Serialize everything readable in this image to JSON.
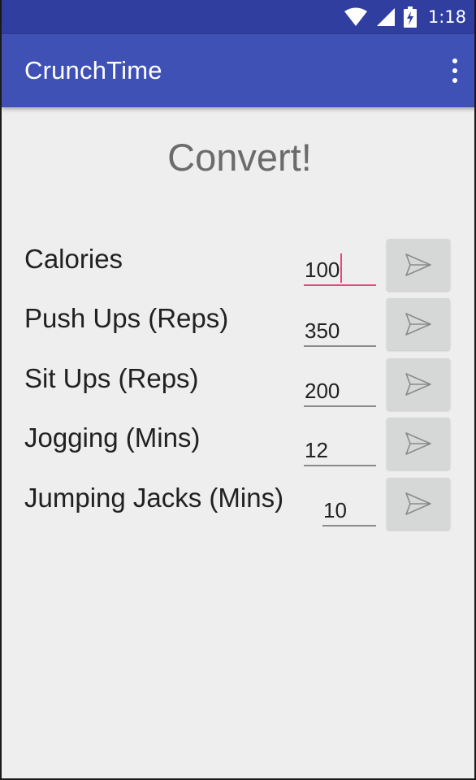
{
  "status_bar": {
    "time": "1:18",
    "icons": [
      "wifi-icon",
      "cell-signal-icon",
      "battery-charging-icon"
    ]
  },
  "app_bar": {
    "title": "CrunchTime",
    "menu_icon": "overflow-menu-icon"
  },
  "main": {
    "heading": "Convert!",
    "rows": [
      {
        "label": "Calories",
        "value": "100",
        "focused": true
      },
      {
        "label": "Push Ups (Reps)",
        "value": "350",
        "focused": false
      },
      {
        "label": "Sit Ups (Reps)",
        "value": "200",
        "focused": false
      },
      {
        "label": "Jogging (Mins)",
        "value": "12",
        "focused": false
      },
      {
        "label": "Jumping Jacks (Mins)",
        "value": "10",
        "focused": false
      }
    ],
    "button_icon": "send-icon"
  },
  "colors": {
    "status_bar": "#303f9f",
    "app_bar": "#3f51b5",
    "accent": "#e8467c",
    "background": "#eeeeee"
  }
}
